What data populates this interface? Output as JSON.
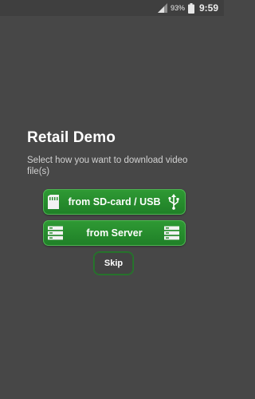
{
  "status_bar": {
    "battery_percent": "93%",
    "time": "9:59",
    "icons": [
      "signal-icon",
      "battery-icon"
    ]
  },
  "main": {
    "title": "Retail Demo",
    "subtitle": "Select how you want to download video file(s)",
    "buttons": {
      "sd_card": {
        "label": "from SD-card / USB",
        "left_icon": "sd-card-icon",
        "right_icon": "usb-icon"
      },
      "server": {
        "label": "from Server",
        "left_icon": "server-icon",
        "right_icon": "server-icon"
      },
      "skip": {
        "label": "Skip"
      }
    }
  },
  "colors": {
    "background": "#474747",
    "status_bar": "#3f3f3f",
    "button_green": "#2a8f2f",
    "skip_border": "#227a2a"
  }
}
